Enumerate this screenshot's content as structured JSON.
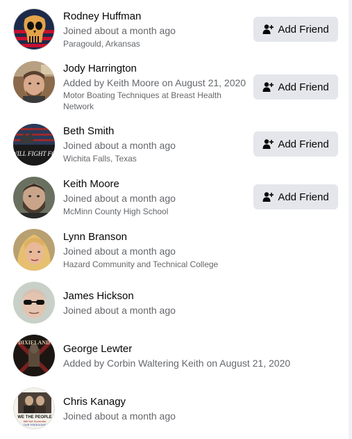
{
  "colors": {
    "button_bg": "#e4e6eb",
    "name_text": "#050505",
    "secondary_text": "#65676b"
  },
  "add_friend_label": "Add Friend",
  "members": [
    {
      "name": "Rodney Huffman",
      "subtitle": "Joined about a month ago",
      "detail": "Paragould, Arkansas",
      "avatar_icon": "punisher-skull-flag-avatar",
      "has_add_button": true
    },
    {
      "name": "Jody Harrington",
      "subtitle": "Added by Keith Moore on August 21, 2020",
      "detail": "Motor Boating Techniques at Breast Health Network",
      "avatar_icon": "man-selfie-avatar",
      "has_add_button": true
    },
    {
      "name": "Beth Smith",
      "subtitle": "Joined about a month ago",
      "detail": "Wichita Falls, Texas",
      "avatar_icon": "flag-slogan-avatar",
      "avatar_text": "I WILL FIGHT FOR",
      "has_add_button": true
    },
    {
      "name": "Keith Moore",
      "subtitle": "Joined about a month ago",
      "detail": "McMinn County High School",
      "avatar_icon": "bearded-man-avatar",
      "has_add_button": true
    },
    {
      "name": "Lynn Branson",
      "subtitle": "Joined about a month ago",
      "detail": "Hazard Community and Technical College",
      "avatar_icon": "blonde-woman-avatar",
      "has_add_button": false
    },
    {
      "name": "James Hickson",
      "subtitle": "Joined about a month ago",
      "detail": "",
      "avatar_icon": "man-sunglasses-avatar",
      "has_add_button": false
    },
    {
      "name": "George Lewter",
      "subtitle": "Added by Corbin Waltering Keith on August 21, 2020",
      "detail": "",
      "avatar_icon": "dixieland-flag-avatar",
      "avatar_text": "DIXIELAND",
      "has_add_button": false
    },
    {
      "name": "Chris Kanagy",
      "subtitle": "Joined about a month ago",
      "detail": "",
      "avatar_icon": "we-the-people-avatar",
      "avatar_text": "WE THE PEOPLE",
      "avatar_subtext": "Will Not Surrender",
      "avatar_subtext2": "OUR FREEDOMS",
      "has_add_button": false
    }
  ]
}
